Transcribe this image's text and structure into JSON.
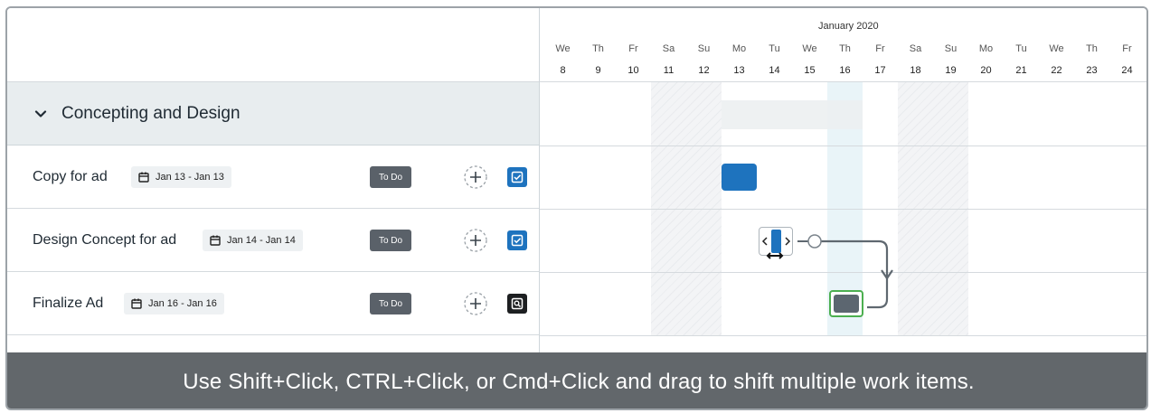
{
  "groups": [
    {
      "title": "Concepting and Design"
    }
  ],
  "tasks": [
    {
      "name": "Copy for ad",
      "date_range": "Jan 13 - Jan 13",
      "status": "To Do"
    },
    {
      "name": "Design Concept for ad",
      "date_range": "Jan 14 - Jan 14",
      "status": "To Do"
    },
    {
      "name": "Finalize Ad",
      "date_range": "Jan 16 - Jan 16",
      "status": "To Do"
    }
  ],
  "timeline": {
    "month": "January 2020",
    "days": [
      {
        "dow": "We",
        "num": "8"
      },
      {
        "dow": "Th",
        "num": "9"
      },
      {
        "dow": "Fr",
        "num": "10"
      },
      {
        "dow": "Sa",
        "num": "11"
      },
      {
        "dow": "Su",
        "num": "12"
      },
      {
        "dow": "Mo",
        "num": "13"
      },
      {
        "dow": "Tu",
        "num": "14"
      },
      {
        "dow": "We",
        "num": "15"
      },
      {
        "dow": "Th",
        "num": "16"
      },
      {
        "dow": "Fr",
        "num": "17"
      },
      {
        "dow": "Sa",
        "num": "18"
      },
      {
        "dow": "Su",
        "num": "19"
      },
      {
        "dow": "Mo",
        "num": "20"
      },
      {
        "dow": "Tu",
        "num": "21"
      },
      {
        "dow": "We",
        "num": "22"
      },
      {
        "dow": "Th",
        "num": "23"
      },
      {
        "dow": "Fr",
        "num": "24"
      }
    ]
  },
  "icons": {
    "collapse": "chevron-down-icon",
    "date": "calendar-icon",
    "add": "plus-circle-icon",
    "task_checked": "checkbox-icon",
    "task_review": "review-icon",
    "resize": "resize-arrows-icon"
  },
  "colors": {
    "accent": "#1e73be",
    "status_pill": "#5a6169",
    "group_row": "#e8edef",
    "selection_outline": "#4caf50",
    "caption_bg": "#62676b"
  },
  "caption": "Use Shift+Click, CTRL+Click, or Cmd+Click and drag to shift multiple work items."
}
